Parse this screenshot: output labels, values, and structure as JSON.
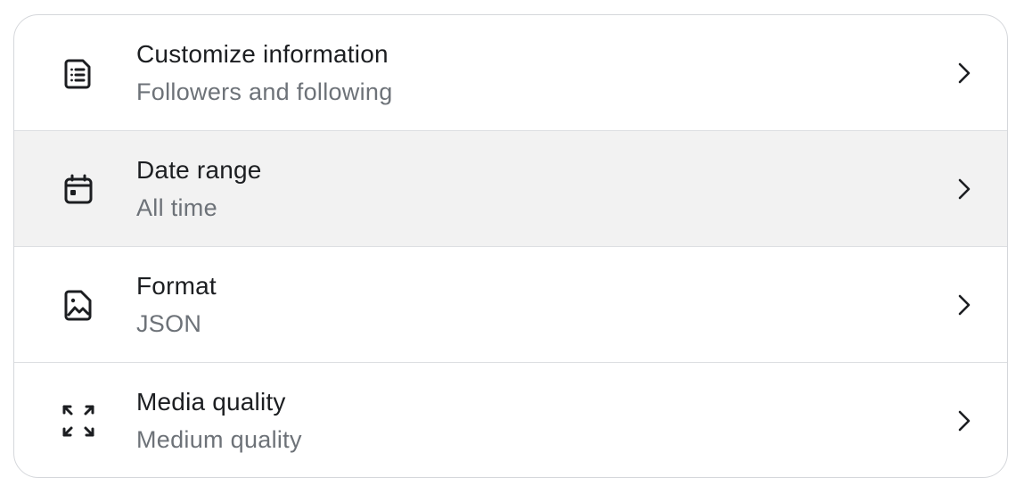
{
  "settings": {
    "items": [
      {
        "title": "Customize information",
        "subtitle": "Followers and following",
        "icon": "document-list-icon"
      },
      {
        "title": "Date range",
        "subtitle": "All time",
        "icon": "calendar-icon"
      },
      {
        "title": "Format",
        "subtitle": "JSON",
        "icon": "image-file-icon"
      },
      {
        "title": "Media quality",
        "subtitle": "Medium quality",
        "icon": "expand-icon"
      }
    ]
  },
  "colors": {
    "title": "#1c1e21",
    "subtitle": "#6d7278",
    "highlight_bg": "#f2f2f2",
    "border": "#d5d7db"
  }
}
